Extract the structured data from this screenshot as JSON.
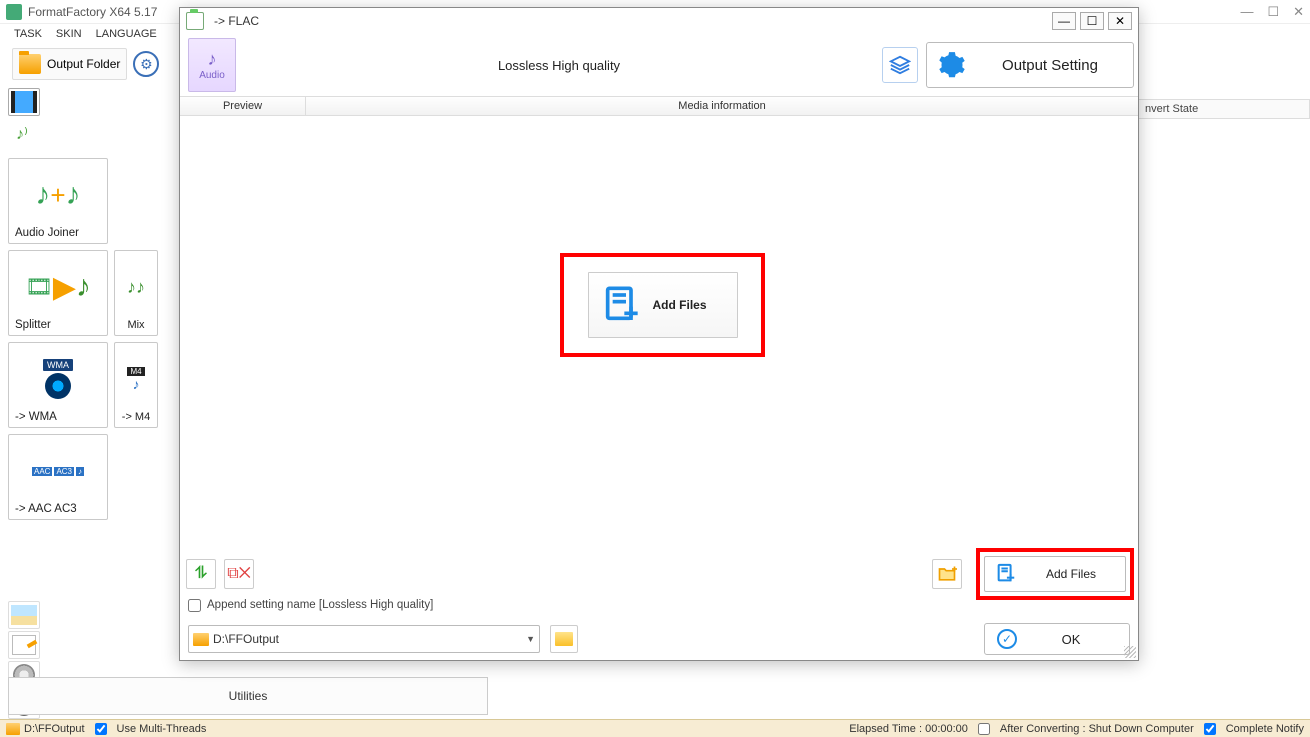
{
  "main_window": {
    "title": "FormatFactory X64 5.17",
    "menu": {
      "task": "TASK",
      "skin": "SKIN",
      "language": "LANGUAGE"
    },
    "output_folder_label": "Output Folder",
    "convert_state_label": "nvert State"
  },
  "sidebar": {
    "items": [
      {
        "label": "Audio Joiner"
      },
      {
        "label": "Splitter"
      },
      {
        "label": "Mix"
      },
      {
        "label": "-> WMA",
        "badge": "WMA"
      },
      {
        "label": "-> M4",
        "badge": "M4"
      },
      {
        "label": "-> AAC AC3"
      }
    ],
    "utilities": "Utilities"
  },
  "dialog": {
    "title": "-> FLAC",
    "audio_tile_label": "Audio",
    "quality": "Lossless High quality",
    "output_setting": "Output Setting",
    "columns": {
      "preview": "Preview",
      "media_info": "Media information"
    },
    "add_files_center": "Add Files",
    "append_setting_label": "Append setting name [Lossless High quality]",
    "output_path": "D:\\FFOutput",
    "add_files_btn": "Add Files",
    "ok": "OK"
  },
  "statusbar": {
    "path": "D:\\FFOutput",
    "multi_threads": "Use Multi-Threads",
    "elapsed": "Elapsed Time : 00:00:00",
    "after_converting": "After Converting : Shut Down Computer",
    "complete_notify": "Complete Notify"
  }
}
